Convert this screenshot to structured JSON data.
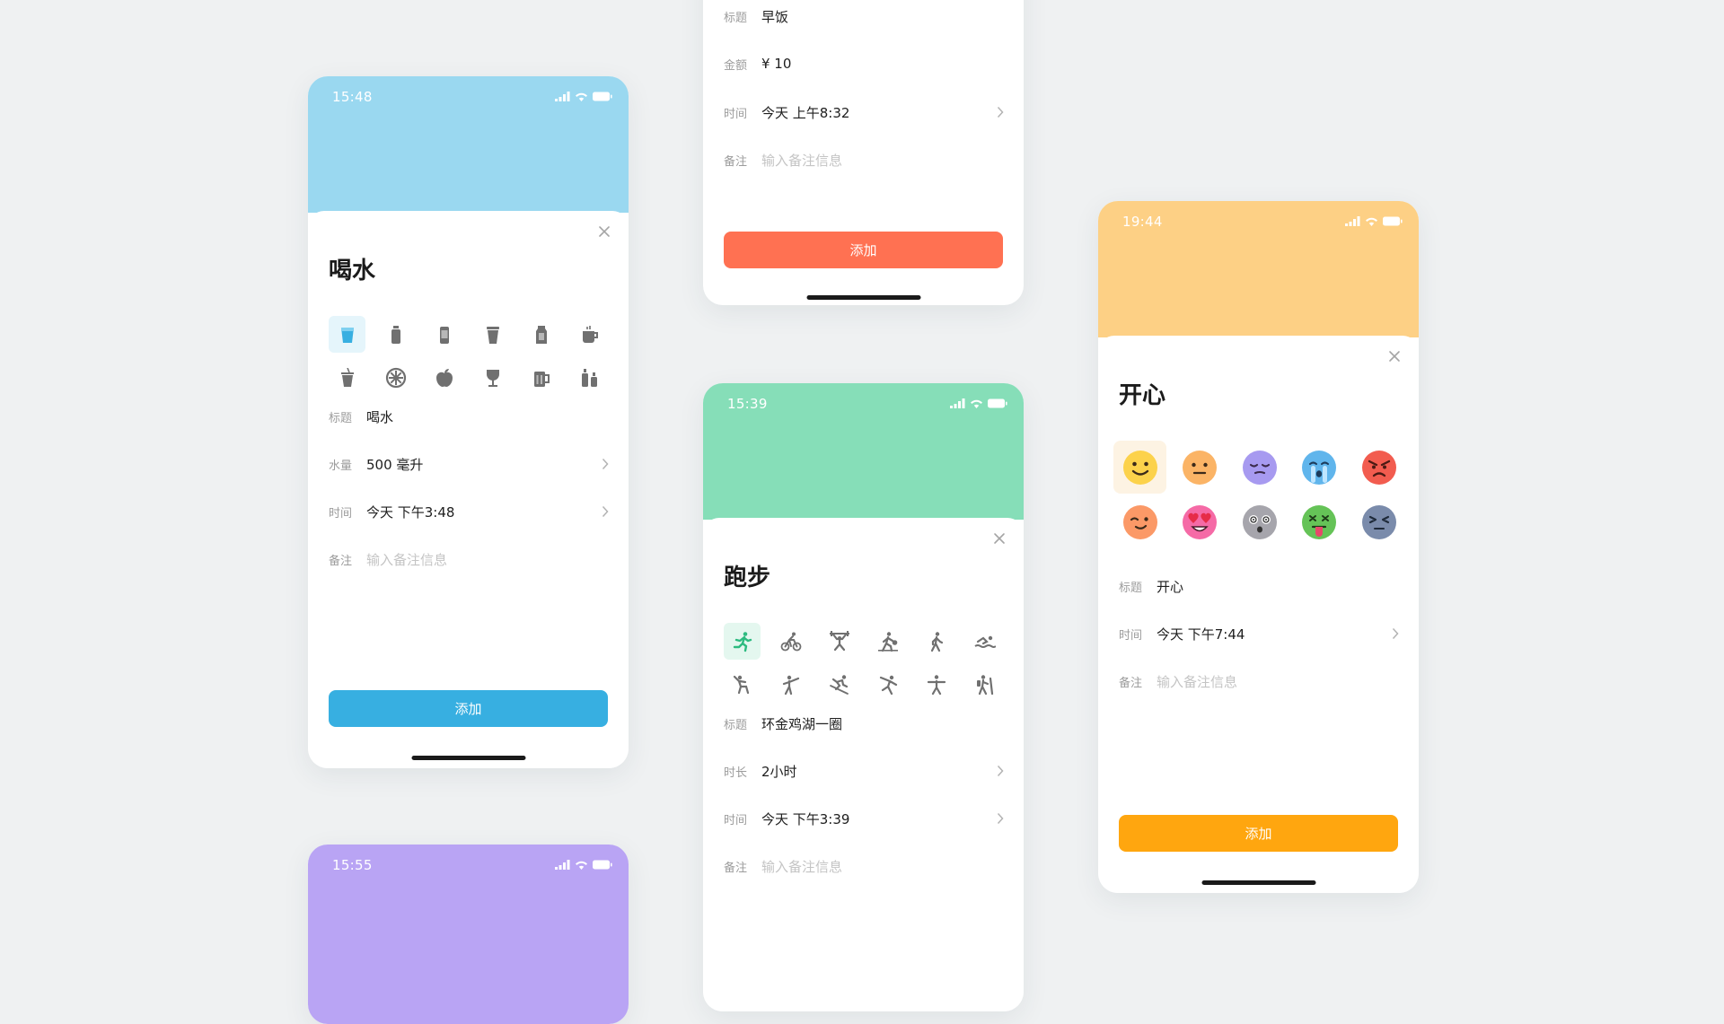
{
  "water": {
    "status_time": "15:48",
    "header_color": "#9ad8f0",
    "title": "喝水",
    "icons": [
      "cup-icon",
      "bottle-icon",
      "can-icon",
      "paper-cup-icon",
      "milk-carton-icon",
      "tea-cup-icon",
      "bubble-tea-icon",
      "lemon-slice-icon",
      "apple-icon",
      "wine-glass-icon",
      "beer-mug-icon",
      "bottles-icon"
    ],
    "selected_icon": "cup-icon",
    "fields": [
      {
        "label": "标题",
        "value": "喝水"
      },
      {
        "label": "水量",
        "value": "500 毫升"
      },
      {
        "label": "时间",
        "value": "今天 下午3:48"
      },
      {
        "label": "备注",
        "placeholder": "输入备注信息"
      }
    ],
    "button_label": "添加",
    "accent": "#37afe1"
  },
  "breakfast": {
    "fields": [
      {
        "label": "标题",
        "value": "早饭"
      },
      {
        "label": "金额",
        "value": "¥ 10"
      },
      {
        "label": "时间",
        "value": "今天 上午8:32"
      },
      {
        "label": "备注",
        "placeholder": "输入备注信息"
      }
    ],
    "button_label": "添加",
    "accent": "#ff7152"
  },
  "running": {
    "status_time": "15:39",
    "header_color": "#86deb8",
    "title": "跑步",
    "icons": [
      "running-icon",
      "cycling-icon",
      "weightlifting-icon",
      "basketball-icon",
      "walking-icon",
      "swimming-icon",
      "climbing-icon",
      "martial-arts-icon",
      "skiing-icon",
      "dancing-icon",
      "yoga-icon",
      "hiking-icon"
    ],
    "selected_icon": "running-icon",
    "fields": [
      {
        "label": "标题",
        "value": "环金鸡湖一圈"
      },
      {
        "label": "时长",
        "value": "2小时"
      },
      {
        "label": "时间",
        "value": "今天 下午3:39"
      },
      {
        "label": "备注",
        "placeholder": "输入备注信息"
      }
    ],
    "accent": "#36c58a"
  },
  "mood": {
    "status_time": "19:44",
    "header_color": "#fdd085",
    "title": "开心",
    "emojis": [
      "happy-face-icon",
      "neutral-face-icon",
      "sleepy-face-icon",
      "crying-face-icon",
      "angry-face-icon",
      "winking-face-icon",
      "heart-eyes-face-icon",
      "dizzy-face-icon",
      "sick-face-icon",
      "tired-face-icon"
    ],
    "selected_emoji": "happy-face-icon",
    "fields": [
      {
        "label": "标题",
        "value": "开心"
      },
      {
        "label": "时间",
        "value": "今天 下午7:44"
      },
      {
        "label": "备注",
        "placeholder": "输入备注信息"
      }
    ],
    "button_label": "添加",
    "accent": "#ffa60f"
  },
  "purple": {
    "status_time": "15:55",
    "header_color": "#b9a4f4"
  }
}
